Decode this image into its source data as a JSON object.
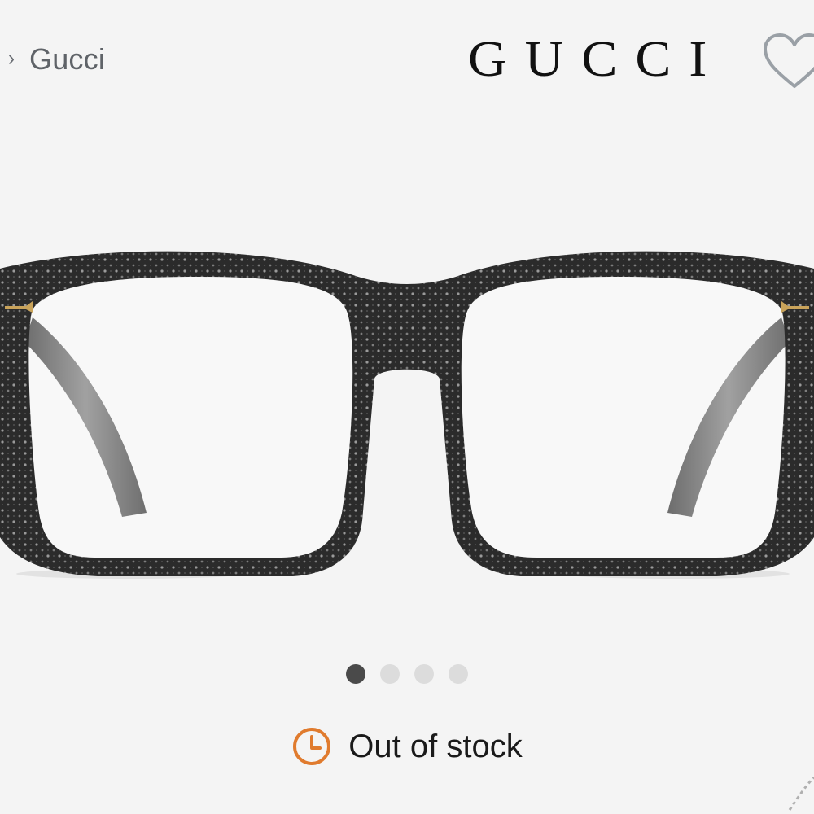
{
  "breadcrumb": {
    "separator_icon": "chevron-right-icon",
    "label": "Gucci"
  },
  "brand": {
    "logo_text": "GUCCI"
  },
  "favorite": {
    "icon": "heart-outline-icon",
    "color": "#9aa0a6"
  },
  "gallery": {
    "image_subject": "glasses-image",
    "total_images": 4,
    "active_index": 0,
    "dot_active_color": "#4a4a4a",
    "dot_inactive_color": "#dcdcdc"
  },
  "availability": {
    "icon": "clock-icon",
    "icon_color": "#e07b2e",
    "text": "Out of stock"
  }
}
